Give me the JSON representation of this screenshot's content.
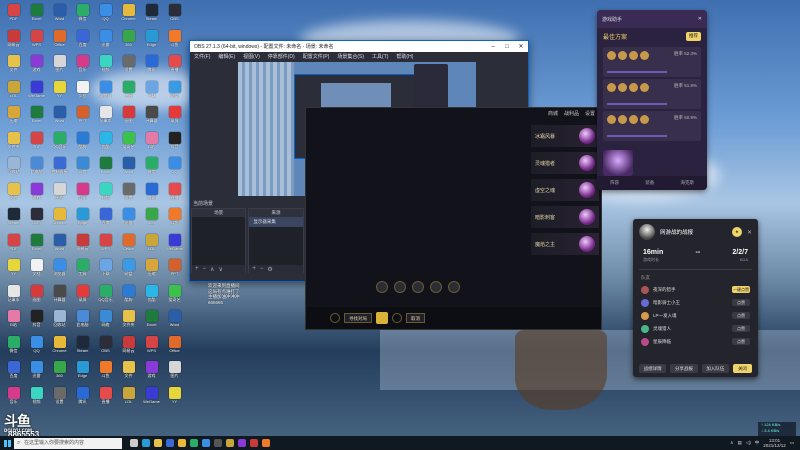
{
  "desktop": {
    "icons": [
      {
        "label": "PDF",
        "color": "#d64545"
      },
      {
        "label": "Excel",
        "color": "#1f7a3e"
      },
      {
        "label": "Word",
        "color": "#2b5ea8"
      },
      {
        "label": "微信",
        "color": "#2aae67"
      },
      {
        "label": "QQ",
        "color": "#3a8ee6"
      },
      {
        "label": "Chrome",
        "color": "#e6b93a"
      },
      {
        "label": "Steam",
        "color": "#1e2a3a"
      },
      {
        "label": "OBS",
        "color": "#2b2e38"
      },
      {
        "label": "网易云",
        "color": "#c93a3a"
      },
      {
        "label": "WPS",
        "color": "#d64545"
      },
      {
        "label": "Office",
        "color": "#e06a2a"
      },
      {
        "label": "百度",
        "color": "#3a66d6"
      },
      {
        "label": "迅雷",
        "color": "#3a8ee6"
      },
      {
        "label": "360",
        "color": "#3aa64a"
      },
      {
        "label": "Edge",
        "color": "#2a9ad6"
      },
      {
        "label": "斗鱼",
        "color": "#f07a2a"
      },
      {
        "label": "文件",
        "color": "#e6c24a"
      },
      {
        "label": "游戏",
        "color": "#8a3ad6"
      },
      {
        "label": "图片",
        "color": "#d6d6d6"
      },
      {
        "label": "音乐",
        "color": "#d63a8a"
      },
      {
        "label": "视频",
        "color": "#3ad6c2"
      },
      {
        "label": "设置",
        "color": "#6a6a6a"
      },
      {
        "label": "腾讯",
        "color": "#2a6ad6"
      },
      {
        "label": "直播",
        "color": "#e64a4a"
      },
      {
        "label": "LOL",
        "color": "#c9a53a"
      },
      {
        "label": "WeGame",
        "color": "#3a3ad6"
      },
      {
        "label": "YY",
        "color": "#e6d63a"
      },
      {
        "label": "文档",
        "color": "#f2f2f2"
      },
      {
        "label": "浏览器",
        "color": "#3a8ee6"
      },
      {
        "label": "工具",
        "color": "#2aae67"
      },
      {
        "label": "下载",
        "color": "#6aa6e6"
      },
      {
        "label": "网盘",
        "color": "#3a9ae6"
      },
      {
        "label": "压缩",
        "color": "#d6a63a"
      },
      {
        "label": "Excel",
        "color": "#1f7a3e"
      },
      {
        "label": "Word",
        "color": "#2b5ea8"
      },
      {
        "label": "PPT",
        "color": "#d6602a"
      },
      {
        "label": "记事本",
        "color": "#e6e6e6"
      },
      {
        "label": "画图",
        "color": "#d63a3a"
      },
      {
        "label": "计算器",
        "color": "#4a4a4a"
      },
      {
        "label": "录屏",
        "color": "#e63a3a"
      },
      {
        "label": "文件夹",
        "color": "#e6c24a"
      },
      {
        "label": "PDF",
        "color": "#d64545"
      },
      {
        "label": "QQ音乐",
        "color": "#2aae67"
      },
      {
        "label": "酷狗",
        "color": "#2a7ad6"
      },
      {
        "label": "优酷",
        "color": "#2ab6e6"
      },
      {
        "label": "爱奇艺",
        "color": "#3ac24a"
      },
      {
        "label": "B站",
        "color": "#e67aa6"
      },
      {
        "label": "抖音",
        "color": "#222222"
      },
      {
        "label": "回收站",
        "color": "#9ab6d6"
      },
      {
        "label": "此电脑",
        "color": "#4a8ad6"
      },
      {
        "label": "控制面板",
        "color": "#3a6ad6"
      },
      {
        "label": "网络",
        "color": "#3a8ad6"
      },
      {
        "label": "Excel",
        "color": "#1f7a3e"
      },
      {
        "label": "Word",
        "color": "#2b5ea8"
      },
      {
        "label": "微信",
        "color": "#2aae67"
      },
      {
        "label": "QQ",
        "color": "#3a8ee6"
      },
      {
        "label": "文件",
        "color": "#e6c24a"
      },
      {
        "label": "游戏",
        "color": "#8a3ad6"
      },
      {
        "label": "图片",
        "color": "#d6d6d6"
      },
      {
        "label": "音乐",
        "color": "#d63a8a"
      },
      {
        "label": "视频",
        "color": "#3ad6c2"
      },
      {
        "label": "设置",
        "color": "#6a6a6a"
      },
      {
        "label": "腾讯",
        "color": "#2a6ad6"
      },
      {
        "label": "直播",
        "color": "#e64a4a"
      },
      {
        "label": "Steam",
        "color": "#1e2a3a"
      },
      {
        "label": "OBS",
        "color": "#2b2e38"
      },
      {
        "label": "Chrome",
        "color": "#e6b93a"
      },
      {
        "label": "Edge",
        "color": "#2a9ad6"
      },
      {
        "label": "百度",
        "color": "#3a66d6"
      },
      {
        "label": "迅雷",
        "color": "#3a8ee6"
      },
      {
        "label": "360",
        "color": "#3aa64a"
      },
      {
        "label": "斗鱼",
        "color": "#f07a2a"
      },
      {
        "label": "PDF",
        "color": "#d64545"
      },
      {
        "label": "Excel",
        "color": "#1f7a3e"
      },
      {
        "label": "Word",
        "color": "#2b5ea8"
      },
      {
        "label": "网易云",
        "color": "#c93a3a"
      },
      {
        "label": "WPS",
        "color": "#d64545"
      },
      {
        "label": "Office",
        "color": "#e06a2a"
      },
      {
        "label": "LOL",
        "color": "#c9a53a"
      },
      {
        "label": "WeGame",
        "color": "#3a3ad6"
      },
      {
        "label": "YY",
        "color": "#e6d63a"
      },
      {
        "label": "文档",
        "color": "#f2f2f2"
      },
      {
        "label": "浏览器",
        "color": "#3a8ee6"
      },
      {
        "label": "工具",
        "color": "#2aae67"
      },
      {
        "label": "下载",
        "color": "#6aa6e6"
      },
      {
        "label": "网盘",
        "color": "#3a9ae6"
      },
      {
        "label": "压缩",
        "color": "#d6a63a"
      },
      {
        "label": "PPT",
        "color": "#d6602a"
      },
      {
        "label": "记事本",
        "color": "#e6e6e6"
      },
      {
        "label": "画图",
        "color": "#d63a3a"
      },
      {
        "label": "计算器",
        "color": "#4a4a4a"
      },
      {
        "label": "录屏",
        "color": "#e63a3a"
      },
      {
        "label": "QQ音乐",
        "color": "#2aae67"
      },
      {
        "label": "酷狗",
        "color": "#2a7ad6"
      },
      {
        "label": "优酷",
        "color": "#2ab6e6"
      },
      {
        "label": "爱奇艺",
        "color": "#3ac24a"
      },
      {
        "label": "B站",
        "color": "#e67aa6"
      },
      {
        "label": "抖音",
        "color": "#222222"
      },
      {
        "label": "回收站",
        "color": "#9ab6d6"
      },
      {
        "label": "此电脑",
        "color": "#4a8ad6"
      },
      {
        "label": "网络",
        "color": "#3a8ad6"
      },
      {
        "label": "文件夹",
        "color": "#e6c24a"
      },
      {
        "label": "Excel",
        "color": "#1f7a3e"
      },
      {
        "label": "Word",
        "color": "#2b5ea8"
      },
      {
        "label": "微信",
        "color": "#2aae67"
      },
      {
        "label": "QQ",
        "color": "#3a8ee6"
      },
      {
        "label": "Chrome",
        "color": "#e6b93a"
      },
      {
        "label": "Steam",
        "color": "#1e2a3a"
      },
      {
        "label": "OBS",
        "color": "#2b2e38"
      },
      {
        "label": "网易云",
        "color": "#c93a3a"
      },
      {
        "label": "WPS",
        "color": "#d64545"
      },
      {
        "label": "Office",
        "color": "#e06a2a"
      },
      {
        "label": "百度",
        "color": "#3a66d6"
      },
      {
        "label": "迅雷",
        "color": "#3a8ee6"
      },
      {
        "label": "360",
        "color": "#3aa64a"
      },
      {
        "label": "Edge",
        "color": "#2a9ad6"
      },
      {
        "label": "斗鱼",
        "color": "#f07a2a"
      },
      {
        "label": "文件",
        "color": "#e6c24a"
      },
      {
        "label": "游戏",
        "color": "#8a3ad6"
      },
      {
        "label": "图片",
        "color": "#d6d6d6"
      },
      {
        "label": "音乐",
        "color": "#d63a8a"
      },
      {
        "label": "视频",
        "color": "#3ad6c2"
      },
      {
        "label": "设置",
        "color": "#6a6a6a"
      },
      {
        "label": "腾讯",
        "color": "#2a6ad6"
      },
      {
        "label": "直播",
        "color": "#e64a4a"
      },
      {
        "label": "LOL",
        "color": "#c9a53a"
      },
      {
        "label": "WeGame",
        "color": "#3a3ad6"
      },
      {
        "label": "YY",
        "color": "#e6d63a"
      }
    ]
  },
  "obs": {
    "title": "OBS 27.1.3 (64-bit, windows) - 配置文件: 未命名 - 场景: 未命名",
    "menu": [
      "文件(F)",
      "编辑(E)",
      "视图(V)",
      "停靠部件(D)",
      "配置文件(P)",
      "场景集合(S)",
      "工具(T)",
      "帮助(H)"
    ],
    "scene_label": "当前场景",
    "docks": {
      "scenes": "场景",
      "sources": "来源",
      "mixer": "混音器",
      "transitions": "转场特效",
      "controls": "控件"
    },
    "source_item": "显示器采集",
    "mixer_tracks": [
      "桌面音频",
      "麦克风/Aux"
    ],
    "controls_buttons": [
      "停止推流",
      "开始录制",
      "启动虚拟摄像机",
      "工作室模式",
      "设置",
      "退出"
    ],
    "transition_value": "淡出",
    "duration_label": "时长",
    "duration_value": "300 ms",
    "status": [
      "丢帧 0 (0.0%)",
      "LIVE: 00:00:00",
      "REC: 00:00:00",
      "CPU: 2.5%, 60.00 fps"
    ]
  },
  "danmaku": {
    "lines": [
      "欢迎来到直播间",
      "这局有点难打了",
      "主播加油冲冲冲",
      "666666"
    ]
  },
  "client": {
    "nav": [
      "商城",
      "战利品",
      "设置"
    ],
    "tiles": [
      {
        "label": "冰霜风暴"
      },
      {
        "label": "灵魂猎者"
      },
      {
        "label": "虚空之魂"
      },
      {
        "label": "暗影刺客"
      },
      {
        "label": "魔焰之主"
      }
    ],
    "bottom_buttons": [
      "寻找对局",
      "取消"
    ]
  },
  "recwidget": {
    "header": "游戏助手",
    "title": "最佳方案",
    "badge": "推荐",
    "rows": [
      {
        "rate": "胜率 52.3%"
      },
      {
        "rate": "胜率 51.8%"
      },
      {
        "rate": "胜率 50.9%"
      }
    ],
    "tabs": [
      "阵容",
      "装备",
      "海克斯"
    ]
  },
  "match": {
    "title": "网游战的战报",
    "time_value": "16min",
    "time_label": "游戏时长",
    "dash": "--",
    "kda_value": "2/2/7",
    "kda_label": "KDA",
    "section": "队友",
    "players": [
      {
        "name": "夜深的猎手",
        "btn": "一键点赞",
        "hi": true
      },
      {
        "name": "暗影骑士小王",
        "btn": "点赞",
        "hi": false
      },
      {
        "name": "LP一发入魂",
        "btn": "点赞",
        "hi": false
      },
      {
        "name": "灵魂猎人",
        "btn": "点赞",
        "hi": false
      },
      {
        "name": "星辰降临",
        "btn": "点赞",
        "hi": false
      }
    ],
    "footer": [
      "战绩详情",
      "分享战报",
      "加入队伍",
      "关闭"
    ]
  },
  "stream": {
    "logo": "斗鱼",
    "logo_sub": "DOUYU.COM",
    "room_id": "8865553"
  },
  "net": {
    "up": "↑ 124 KB/s",
    "down": "↓ 3.4 KB/s"
  },
  "taskbar": {
    "search_placeholder": "在这里输入你要搜索的内容",
    "time": "13:01",
    "date": "2021/12/12"
  }
}
